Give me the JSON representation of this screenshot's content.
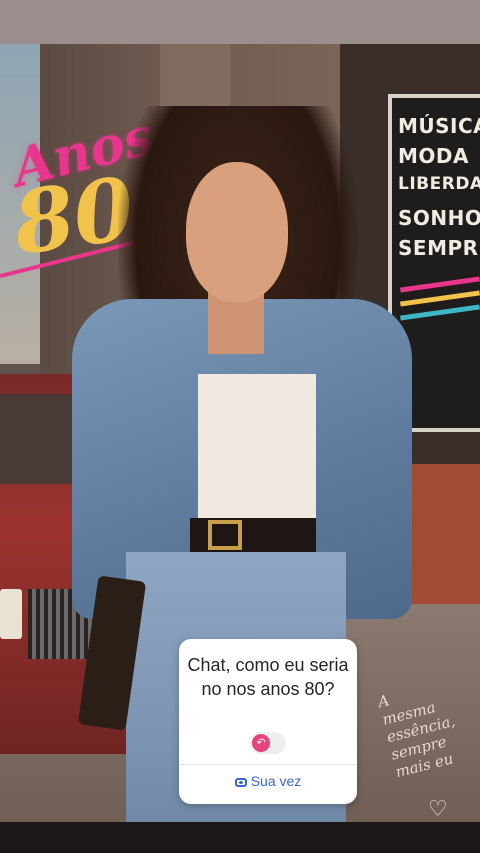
{
  "story": {
    "background_title": {
      "word": "Anos",
      "number": "80"
    },
    "sign_lines": [
      "MÚSICA",
      "MODA",
      "LIBERDADE",
      "SONHOS",
      "SEMPRE"
    ],
    "handwritten_note": [
      "A",
      "mesma",
      "essência,",
      "sempre",
      "mais eu"
    ],
    "heart": "♡",
    "colors": {
      "pink": "#e8368c",
      "yellow": "#f2c34a",
      "link_blue": "#3b67c8"
    }
  },
  "sticker": {
    "question": "Chat, como eu seria no nos anos 80?",
    "toggle_icon": "reply-arrow-icon",
    "action_label": "Sua vez",
    "action_icon": "camera-icon"
  }
}
